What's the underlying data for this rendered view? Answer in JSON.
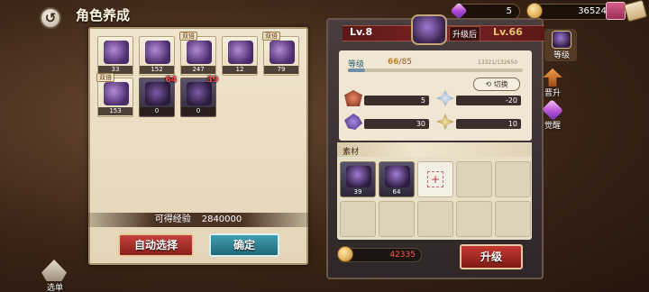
{
  "header": {
    "title": "角色养成"
  },
  "currency": {
    "gems": "5",
    "gold": "36524"
  },
  "materials": [
    {
      "qty": "33",
      "tag": "",
      "dark": false,
      "badge": ""
    },
    {
      "qty": "152",
      "tag": "",
      "dark": false,
      "badge": ""
    },
    {
      "qty": "247",
      "tag": "双倍",
      "dark": false,
      "badge": ""
    },
    {
      "qty": "12",
      "tag": "",
      "dark": false,
      "badge": ""
    },
    {
      "qty": "79",
      "tag": "双倍",
      "dark": false,
      "badge": ""
    },
    {
      "qty": "153",
      "tag": "双倍",
      "dark": false,
      "badge": ""
    },
    {
      "qty": "0",
      "tag": "",
      "dark": true,
      "badge": "64"
    },
    {
      "qty": "0",
      "tag": "",
      "dark": true,
      "badge": "39"
    }
  ],
  "exp_gain": {
    "label": "可得经验",
    "value": "2840000"
  },
  "buttons": {
    "auto_select": "自动选择",
    "confirm": "确定",
    "upgrade": "升级",
    "switch": "切换"
  },
  "level": {
    "before": "Lv.8",
    "after_label": "升级后",
    "after": "Lv.66"
  },
  "grade": {
    "label": "等级",
    "current": "66",
    "max": "/85",
    "exp_text": "13321/132650",
    "exp_fraction": 0.1
  },
  "stats": {
    "atk": "5",
    "spd": "-20",
    "mag": "30",
    "res": "10"
  },
  "material_section": {
    "label": "素材",
    "slots": [
      {
        "qty": "39"
      },
      {
        "qty": "64"
      }
    ]
  },
  "cost": "42335",
  "side_tabs": {
    "level": "等级",
    "promote": "晋升",
    "awaken": "觉醒"
  },
  "menu": {
    "label": "选单"
  }
}
